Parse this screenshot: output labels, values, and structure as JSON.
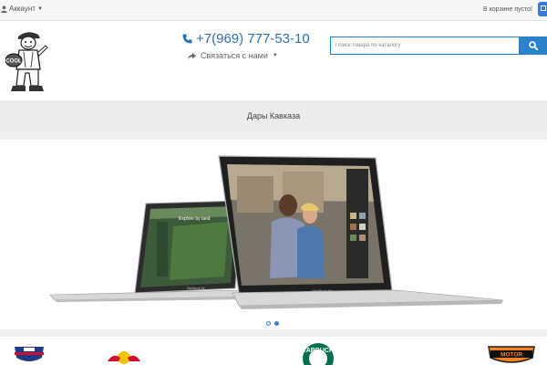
{
  "topbar": {
    "account_label": "Аккаунт",
    "cart_text": "В корзине пусто!"
  },
  "header": {
    "phone": "+7(969) 777-53-10",
    "contact_label": "Связаться с нами",
    "logo_text": "COOL"
  },
  "search": {
    "placeholder": "Поиск товара по каталогу"
  },
  "category": {
    "title": "Дары Кавказа"
  },
  "slider": {
    "slide_count": 2,
    "active_index": 1,
    "slide_caption_small": "Explore by land",
    "laptop_brand": "MacBook Air"
  },
  "brands": {
    "items": [
      "nfl-logo",
      "redbull-logo",
      "starbucks-logo",
      "harley-logo"
    ],
    "starbucks_text": "STARBUCKS",
    "harley_text": "MOTOR"
  },
  "colors": {
    "accent": "#2b82c9",
    "phone": "#2f6fb5",
    "band": "#ececec"
  }
}
